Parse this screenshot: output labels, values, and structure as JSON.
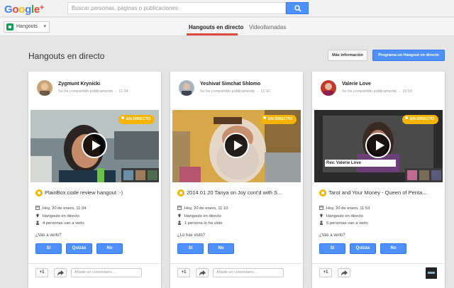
{
  "app": {
    "logo_letters": [
      {
        "text": "G",
        "color": "#4285f4"
      },
      {
        "text": "o",
        "color": "#ea4335"
      },
      {
        "text": "o",
        "color": "#fbbc05"
      },
      {
        "text": "g",
        "color": "#4285f4"
      },
      {
        "text": "l",
        "color": "#34a853"
      },
      {
        "text": "e",
        "color": "#ea4335"
      },
      {
        "text": "+",
        "color": "#dd4b39"
      }
    ],
    "search_placeholder": "Buscar personas, páginas o publicaciones"
  },
  "subnav": {
    "app_select": "Hangouts",
    "tabs": [
      {
        "label": "Hangouts en directo",
        "active": true
      },
      {
        "label": "Videollamadas",
        "active": false
      }
    ]
  },
  "page": {
    "title": "Hangouts en directo",
    "more_info": "Más información",
    "schedule": "Programa un Hangout en directo"
  },
  "colors": {
    "accent_blue": "#4d90fe",
    "live_yellow": "#f4b400",
    "tab_red": "#dd4b39"
  },
  "cards": [
    {
      "author": "Zygmunt Krynicki",
      "shared": "Se ha compartido públicamente",
      "time": "11:34",
      "live": "EN DIRECTO",
      "title": "PlainBox code review hangout :-)",
      "date": "Hoy, 20 de enero, 11:34",
      "status": "Hangouts en directo",
      "people": "4 personas van a verlo",
      "question": "¿Vas a verlo?",
      "buttons": [
        "Sí",
        "Quizás",
        "No"
      ],
      "plus_one": "+1",
      "comment_placeholder": "Añade un comentario..."
    },
    {
      "author": "Yeshivat Simchat Shlomo",
      "shared": "Se ha compartido públicamente",
      "time": "11:10",
      "live": "EN DIRECTO",
      "title": "2014 01 20 Tanya on Joy cont'd with S...",
      "date": "Hoy, 20 de enero, 11:10",
      "status": "Hangouts en directo",
      "people": "1 persona lo ha visto",
      "question": "¿Lo has visto?",
      "buttons": [
        "Sí",
        "No"
      ],
      "plus_one": "+1",
      "comment_placeholder": "Añade un comentario..."
    },
    {
      "author": "Valerie Love",
      "shared": "Se ha compartido públicamente",
      "time": "10:53",
      "live": "EN DIRECTO",
      "overlay": "Rev. Valerie Love",
      "title": "Tarot and Your Money - Queen of Penta...",
      "date": "Hoy, 20 de enero, 11:53",
      "status": "Hangouts en directo",
      "people": "5 personas van a verlo",
      "question": "¿Vas a verlo?",
      "buttons": [
        "Sí",
        "Quizás",
        "No"
      ],
      "plus_one": "+1",
      "comment_placeholder": "Añade un comentario..."
    }
  ]
}
